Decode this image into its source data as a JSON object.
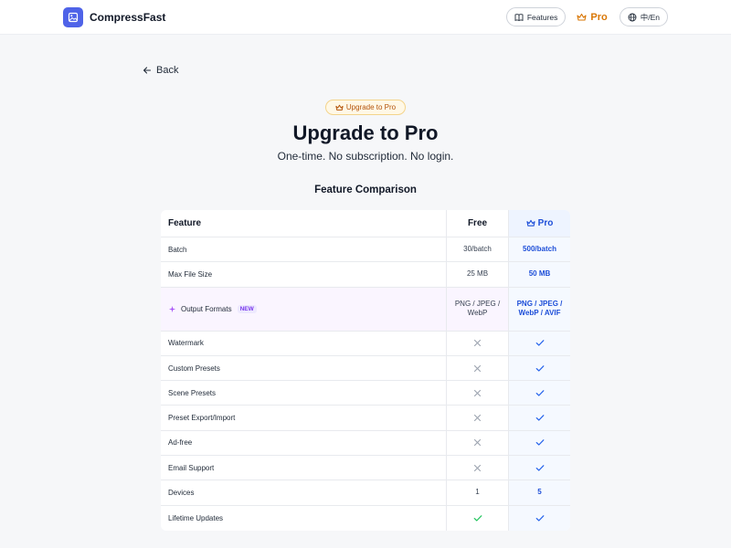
{
  "header": {
    "brand": "CompressFast",
    "features_label": "Features",
    "pro_label": "Pro",
    "lang_label": "中/En"
  },
  "nav": {
    "back_label": "Back"
  },
  "hero": {
    "badge": "Upgrade to Pro",
    "title": "Upgrade to Pro",
    "subtitle": "One-time. No subscription. No login."
  },
  "comparison": {
    "title": "Feature Comparison",
    "headers": {
      "feature": "Feature",
      "free": "Free",
      "pro": "Pro"
    },
    "rows": [
      {
        "feature": "Batch",
        "free": "30/batch",
        "pro": "500/batch"
      },
      {
        "feature": "Max File Size",
        "free": "25 MB",
        "pro": "50 MB"
      },
      {
        "feature": "Output Formats",
        "badge": "NEW",
        "free": "PNG / JPEG / WebP",
        "pro": "PNG / JPEG / WebP / AVIF"
      },
      {
        "feature": "Watermark",
        "free": "x",
        "pro": "check"
      },
      {
        "feature": "Custom Presets",
        "free": "x",
        "pro": "check"
      },
      {
        "feature": "Scene Presets",
        "free": "x",
        "pro": "check"
      },
      {
        "feature": "Preset Export/Import",
        "free": "x",
        "pro": "check"
      },
      {
        "feature": "Ad-free",
        "free": "x",
        "pro": "check"
      },
      {
        "feature": "Email Support",
        "free": "x",
        "pro": "check"
      },
      {
        "feature": "Devices",
        "free": "1",
        "pro": "5"
      },
      {
        "feature": "Lifetime Updates",
        "free": "check",
        "pro": "check"
      }
    ]
  },
  "colors": {
    "accent": "#4f63e8",
    "pro_gold": "#d97706",
    "pro_blue": "#1d4ed8",
    "check_green": "#22c55e",
    "check_blue": "#2563eb",
    "x_gray": "#9ca3af"
  },
  "icons": {
    "logo": "image-icon",
    "features": "book-icon",
    "pro": "crown-icon",
    "lang": "globe-icon",
    "back": "arrow-left-icon",
    "new_feature": "sparkle-icon",
    "yes": "check-icon",
    "no": "x-icon"
  }
}
